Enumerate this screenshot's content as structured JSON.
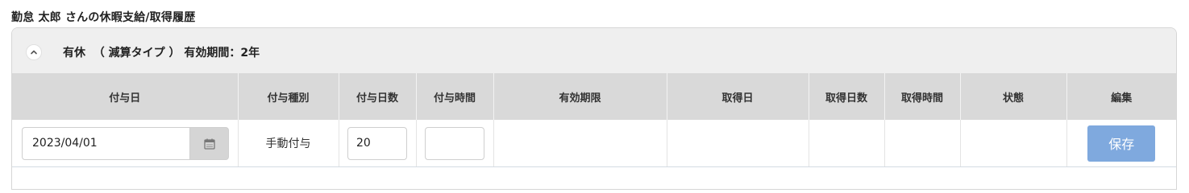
{
  "page": {
    "title": "勤怠 太郎 さんの休暇支給/取得履歴"
  },
  "panel": {
    "collapse_icon": "chevron-up-icon",
    "title": "有休  （ 減算タイプ ） 有効期間：2年"
  },
  "table": {
    "headers": [
      "付与日",
      "付与種別",
      "付与日数",
      "付与時間",
      "有効期限",
      "取得日",
      "取得日数",
      "取得時間",
      "状態",
      "編集"
    ],
    "row": {
      "grant_date": "2023/04/01",
      "calendar_icon": "calendar-icon",
      "grant_type": "手動付与",
      "grant_days": "20",
      "grant_hours": "",
      "expiry": "",
      "acquired_date": "",
      "acquired_days": "",
      "acquired_hours": "",
      "status": "",
      "save_label": "保存"
    }
  },
  "colors": {
    "header_bg": "#efefef",
    "table_header_bg": "#d9d9d9",
    "save_button": "#7fa9de"
  }
}
